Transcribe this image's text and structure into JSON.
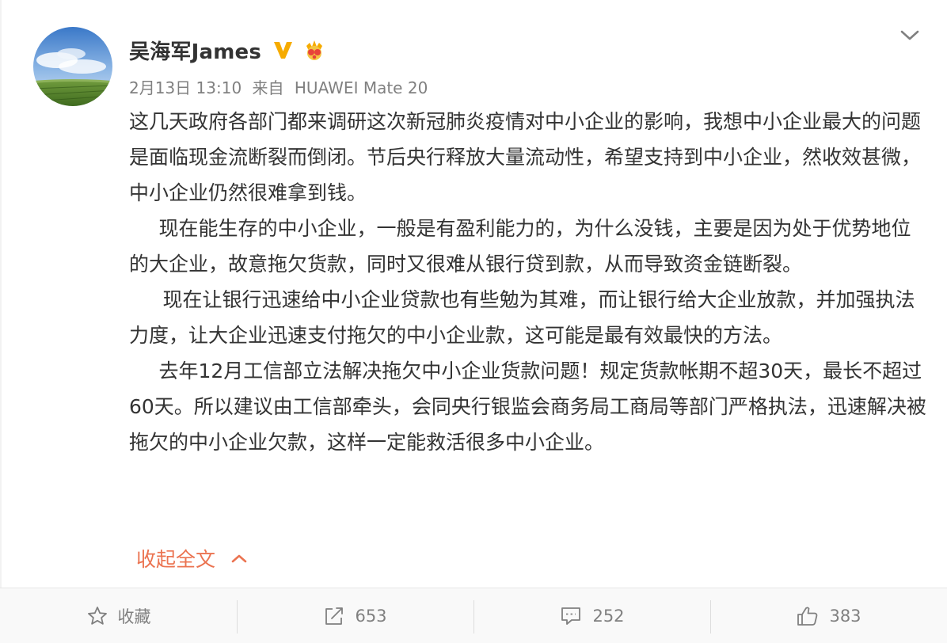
{
  "post": {
    "author": {
      "name": "吴海军James",
      "avatar_icon": "avatar-landscape-icon",
      "verified_icon": "verified-v-icon",
      "member_icon": "crown-member-icon",
      "verified_color": "#f6ab00"
    },
    "meta": {
      "date": "2月13日 13:10",
      "source_prefix": "来自",
      "source": "HUAWEI Mate 20"
    },
    "paragraphs": [
      "这几天政府各部门都来调研这次新冠肺炎疫情对中小企业的影响，我想中小企业最大的问题是面临现金流断裂而倒闭。节后央行释放大量流动性，希望支持到中小企业，然收效甚微，中小企业仍然很难拿到钱。",
      "现在能生存的中小企业，一般是有盈利能力的，为什么没钱，主要是因为处于优势地位的大企业，故意拖欠货款，同时又很难从银行贷到款，从而导致资金链断裂。",
      "现在让银行迅速给中小企业贷款也有些勉为其难，而让银行给大企业放款，并加强执法力度，让大企业迅速支付拖欠的中小企业款，这可能是最有效最快的方法。",
      "去年12月工信部立法解决拖欠中小企业货款问题！规定货款帐期不超30天，最长不超过60天。所以建议由工信部牵头，会同央行银监会商务局工商局等部门严格执法，迅速解决被拖欠的中小企业欠款，这样一定能救活很多中小企业。"
    ],
    "collapse_label": "收起全文",
    "collapse_icon": "chevron-up-icon",
    "accent_color": "#eb7350"
  },
  "actions": {
    "favorite": {
      "label": "收藏",
      "icon": "star-icon"
    },
    "repost": {
      "count": "653",
      "icon": "repost-icon"
    },
    "comment": {
      "count": "252",
      "icon": "comment-icon"
    },
    "like": {
      "count": "383",
      "icon": "thumbs-up-icon"
    }
  },
  "menu_icon": "chevron-down-icon"
}
